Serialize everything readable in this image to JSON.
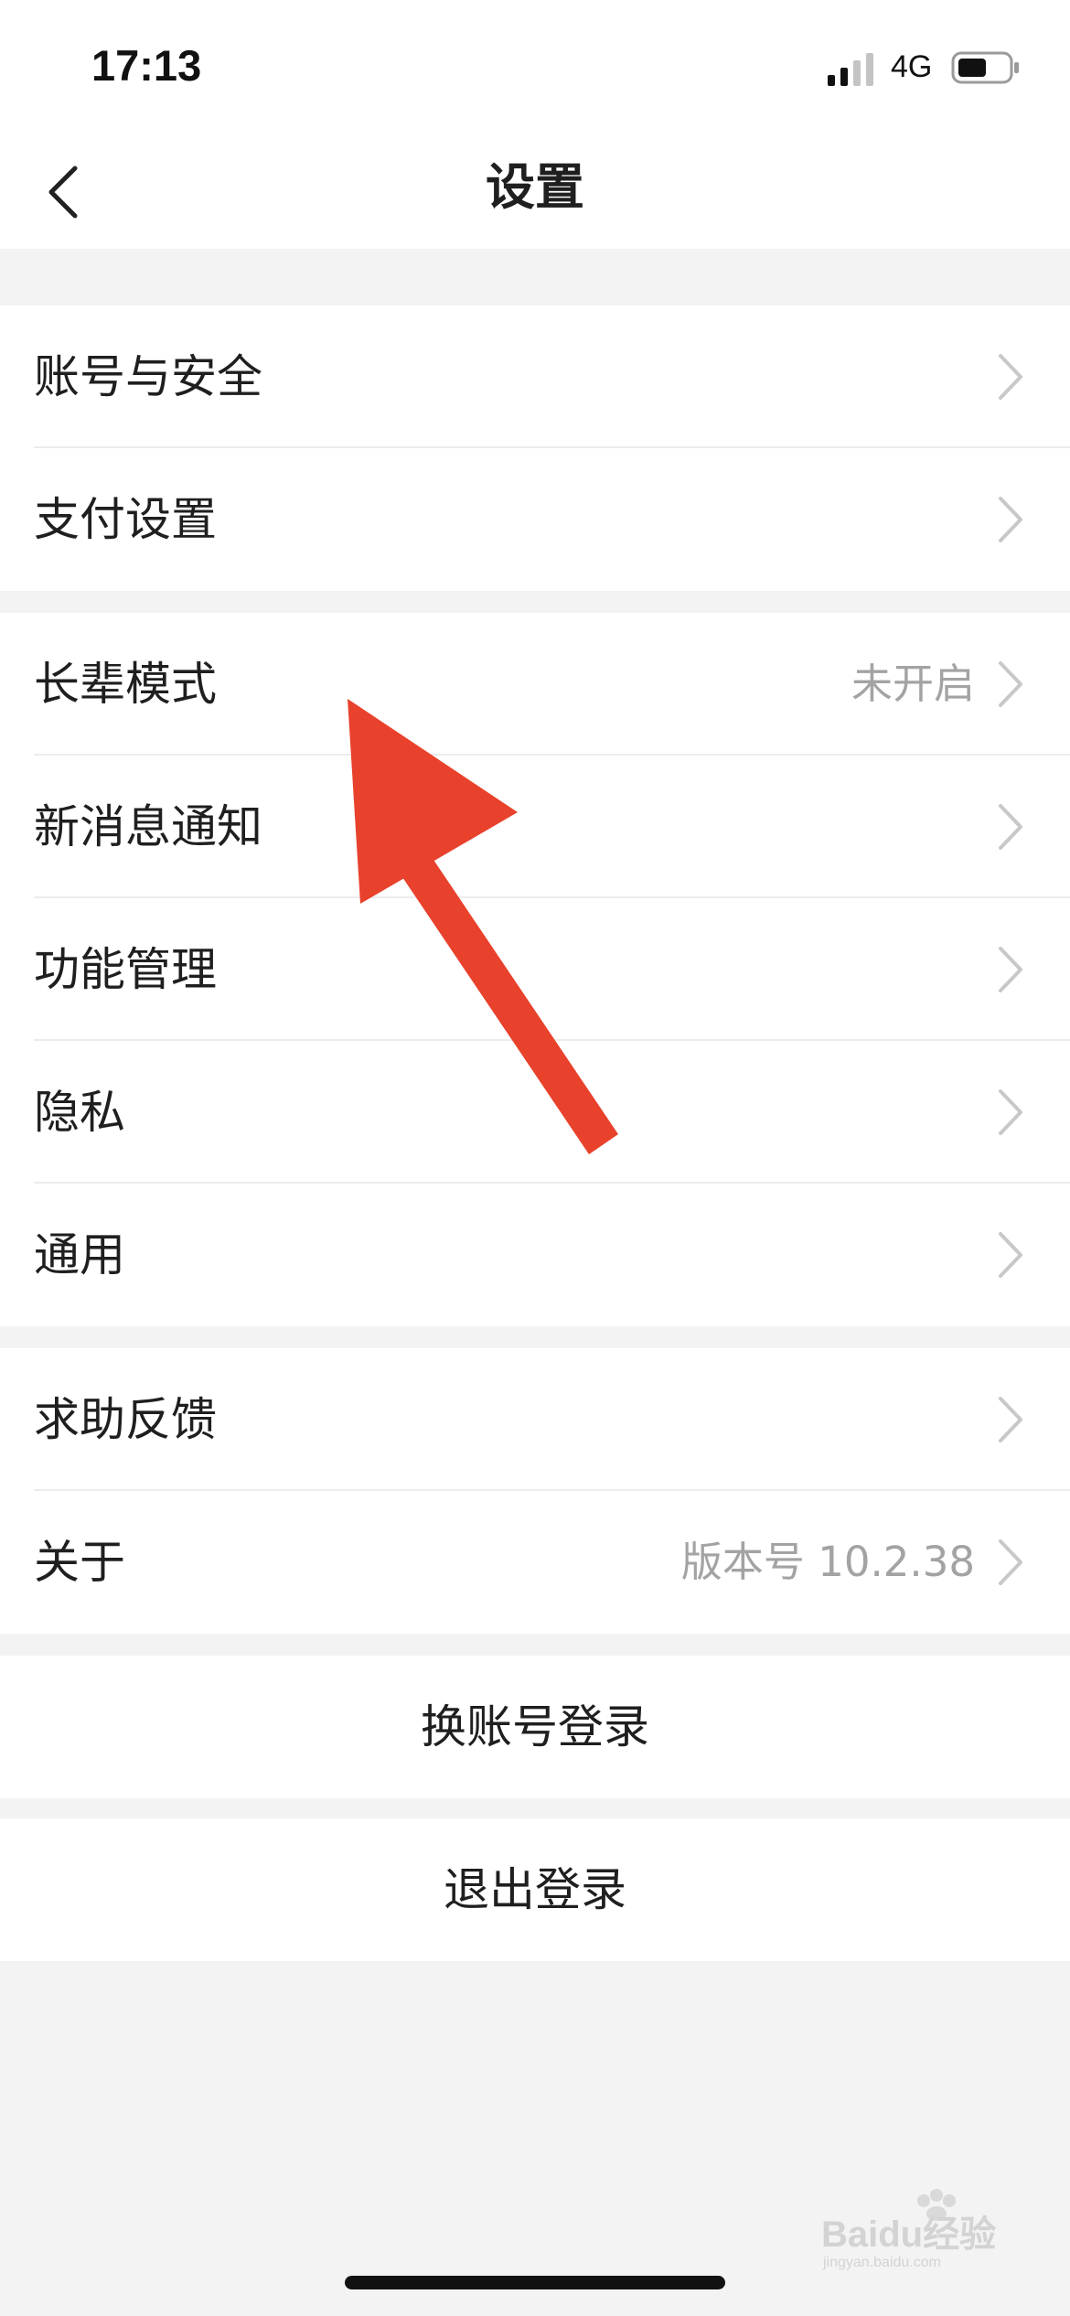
{
  "status_bar": {
    "time": "17:13",
    "network": "4G",
    "signal_icon": "signal-bars-icon",
    "battery_icon": "battery-icon"
  },
  "nav": {
    "title": "设置",
    "back_icon": "chevron-left-icon"
  },
  "groups": [
    {
      "items": [
        {
          "label": "账号与安全",
          "value": ""
        },
        {
          "label": "支付设置",
          "value": ""
        }
      ]
    },
    {
      "items": [
        {
          "label": "长辈模式",
          "value": "未开启"
        },
        {
          "label": "新消息通知",
          "value": ""
        },
        {
          "label": "功能管理",
          "value": ""
        },
        {
          "label": "隐私",
          "value": ""
        },
        {
          "label": "通用",
          "value": ""
        }
      ]
    },
    {
      "items": [
        {
          "label": "求助反馈",
          "value": ""
        },
        {
          "label": "关于",
          "value": "版本号 10.2.38"
        }
      ]
    }
  ],
  "actions": {
    "switch_account": "换账号登录",
    "logout": "退出登录"
  },
  "watermark": {
    "text": "Baidu经验",
    "subtext": "jingyan.baidu.com"
  },
  "colors": {
    "arrow": "#e8412c",
    "background": "#f3f3f3",
    "secondary_text": "#a3a3a3"
  }
}
